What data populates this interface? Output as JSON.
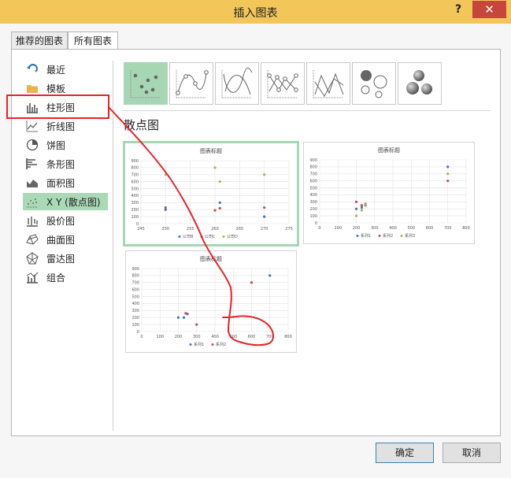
{
  "window": {
    "title": "插入图表",
    "help": "?",
    "close": "✕"
  },
  "tabs": [
    {
      "label": "推荐的图表"
    },
    {
      "label": "所有图表"
    }
  ],
  "sidebar": {
    "items": [
      {
        "label": "最近",
        "icon": "recent-icon"
      },
      {
        "label": "模板",
        "icon": "folder-icon"
      },
      {
        "label": "柱形图",
        "icon": "column-chart-icon"
      },
      {
        "label": "折线图",
        "icon": "line-chart-icon"
      },
      {
        "label": "饼图",
        "icon": "pie-chart-icon"
      },
      {
        "label": "条形图",
        "icon": "bar-chart-icon"
      },
      {
        "label": "面积图",
        "icon": "area-chart-icon"
      },
      {
        "label": "X Y (散点图)",
        "icon": "scatter-chart-icon"
      },
      {
        "label": "股价图",
        "icon": "stock-chart-icon"
      },
      {
        "label": "曲面图",
        "icon": "surface-chart-icon"
      },
      {
        "label": "雷达图",
        "icon": "radar-chart-icon"
      },
      {
        "label": "组合",
        "icon": "combo-chart-icon"
      }
    ],
    "selected_index": 7
  },
  "subtypes": [
    "scatter",
    "scatter-smooth-markers",
    "scatter-smooth",
    "scatter-straight-markers",
    "scatter-straight",
    "bubble",
    "bubble-3d"
  ],
  "section_title": "散点图",
  "colors": {
    "blue": "#4472c4",
    "red": "#c0504d",
    "green": "#9bbb59",
    "accent": "#a7d6b5",
    "titlebar": "#f3c65a",
    "close": "#c7463b"
  },
  "buttons": {
    "ok": "确定",
    "cancel": "取消"
  },
  "chart_data": [
    {
      "type": "scatter",
      "title": "图表标题",
      "xlim": [
        245,
        275
      ],
      "ylim": [
        0,
        900
      ],
      "xticks": [
        245,
        250,
        255,
        260,
        265,
        270,
        275
      ],
      "yticks": [
        0,
        100,
        200,
        300,
        400,
        500,
        600,
        700,
        800,
        900
      ],
      "series": [
        {
          "name": "公司B",
          "color": "#4472c4",
          "points": [
            [
              250,
              200
            ],
            [
              261,
              300
            ],
            [
              270,
              100
            ]
          ]
        },
        {
          "name": "公司C",
          "color": "#c0504d",
          "points": [
            [
              250,
              230
            ],
            [
              260,
              190
            ],
            [
              261,
              220
            ],
            [
              270,
              230
            ]
          ]
        },
        {
          "name": "公司D",
          "color": "#9bbb59",
          "points": [
            [
              250,
              700
            ],
            [
              260,
              800
            ],
            [
              261,
              600
            ],
            [
              270,
              700
            ]
          ]
        }
      ]
    },
    {
      "type": "scatter",
      "title": "图表标题",
      "xlim": [
        0,
        800
      ],
      "ylim": [
        0,
        900
      ],
      "xticks": [
        0,
        100,
        200,
        300,
        400,
        500,
        600,
        700,
        800
      ],
      "yticks": [
        0,
        100,
        200,
        300,
        400,
        500,
        600,
        700,
        800,
        900
      ],
      "series": [
        {
          "name": "系列1",
          "color": "#4472c4",
          "points": [
            [
              200,
              200
            ],
            [
              230,
              220
            ],
            [
              250,
              250
            ],
            [
              700,
              800
            ]
          ]
        },
        {
          "name": "系列2",
          "color": "#c0504d",
          "points": [
            [
              200,
              300
            ],
            [
              230,
              250
            ],
            [
              250,
              270
            ],
            [
              700,
              600
            ]
          ]
        },
        {
          "name": "系列3",
          "color": "#9bbb59",
          "points": [
            [
              200,
              100
            ],
            [
              230,
              180
            ],
            [
              250,
              260
            ],
            [
              700,
              700
            ]
          ]
        }
      ]
    },
    {
      "type": "scatter",
      "title": "图表标题",
      "xlim": [
        0,
        800
      ],
      "ylim": [
        0,
        900
      ],
      "xticks": [
        0,
        100,
        200,
        300,
        400,
        500,
        600,
        700,
        800
      ],
      "yticks": [
        0,
        100,
        200,
        300,
        400,
        500,
        600,
        700,
        800,
        900
      ],
      "series": [
        {
          "name": "系列1",
          "color": "#4472c4",
          "points": [
            [
              200,
              200
            ],
            [
              230,
              200
            ],
            [
              250,
              250
            ],
            [
              700,
              800
            ]
          ]
        },
        {
          "name": "系列2",
          "color": "#c0504d",
          "points": [
            [
              240,
              260
            ],
            [
              300,
              100
            ],
            [
              600,
              700
            ]
          ]
        }
      ]
    }
  ]
}
